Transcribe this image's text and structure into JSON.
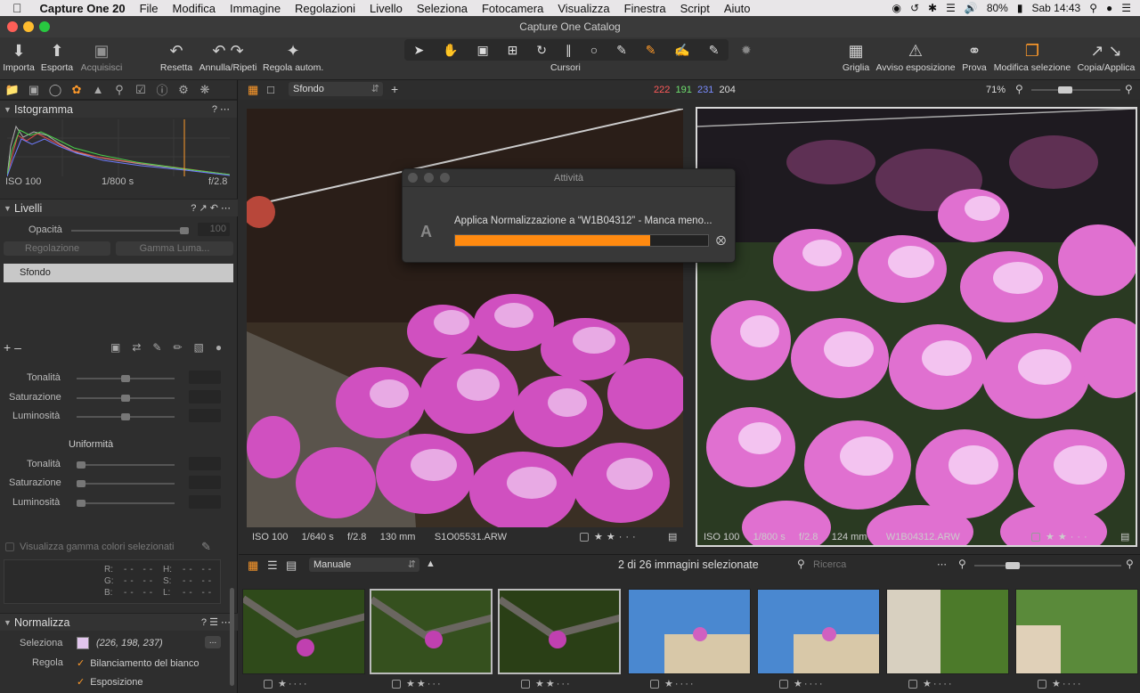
{
  "menubar": {
    "app": "Capture One 20",
    "items": [
      "File",
      "Modifica",
      "Immagine",
      "Regolazioni",
      "Livello",
      "Seleziona",
      "Fotocamera",
      "Visualizza",
      "Finestra",
      "Script",
      "Aiuto"
    ],
    "battery": "80%",
    "clock": "Sab 14:43"
  },
  "window": {
    "title": "Capture One Catalog"
  },
  "toolbar": {
    "import": "Importa",
    "export": "Esporta",
    "capture": "Acquisisci",
    "reset": "Resetta",
    "undo": "Annulla/Ripeti",
    "auto": "Regola autom.",
    "cursors": "Cursori",
    "grid": "Griglia",
    "exposure_warning": "Avviso esposizione",
    "proof": "Prova",
    "edit_selection": "Modifica selezione",
    "copy_apply": "Copia/Applica"
  },
  "viewerbar": {
    "layer_select": "Sfondo",
    "rgb": {
      "r": "222",
      "g": "191",
      "b": "231",
      "l": "204"
    },
    "zoom": "71%",
    "colors": {
      "r": "#ff5a5a",
      "g": "#6fe06f",
      "b": "#7a8cff"
    }
  },
  "histogram": {
    "title": "Istogramma",
    "iso": "ISO 100",
    "shutter": "1/800 s",
    "aperture": "f/2.8"
  },
  "layers": {
    "title": "Livelli",
    "opacity_label": "Opacità",
    "opacity_value": "100",
    "adjustment": "Regolazione",
    "luma": "Gamma Luma...",
    "layer_name": "Sfondo"
  },
  "color_editor": {
    "hue": "Tonalità",
    "saturation": "Saturazione",
    "lightness": "Luminosità",
    "uniformity": "Uniformità",
    "show_gamut": "Visualizza gamma colori selezionati",
    "readout": {
      "r": "R:",
      "g": "G:",
      "b": "B:",
      "h": "H:",
      "s": "S:",
      "l": "L:",
      "dash": "--"
    }
  },
  "normalize": {
    "title": "Normalizza",
    "select_label": "Seleziona",
    "select_value": "(226, 198, 237)",
    "swatch": "#e2c6ed",
    "adjust_label": "Regola",
    "white_balance": "Bilanciamento del bianco",
    "exposure": "Esposizione",
    "more": "..."
  },
  "left_image": {
    "iso": "ISO 100",
    "shutter": "1/640 s",
    "aperture": "f/2.8",
    "focal": "130 mm",
    "filename": "S1O05531.ARW"
  },
  "right_image": {
    "iso": "ISO 100",
    "shutter": "1/800 s",
    "aperture": "f/2.8",
    "focal": "124 mm",
    "filename": "W1B04312.ARW"
  },
  "activity": {
    "title": "Attività",
    "letter": "A",
    "message": "Applica Normalizzazione a “W1B04312” - Manca meno...",
    "progress": 0.77
  },
  "browser": {
    "sort": "Manuale",
    "count": "2 di 26 immagini selezionate",
    "search_placeholder": "Ricerca"
  }
}
